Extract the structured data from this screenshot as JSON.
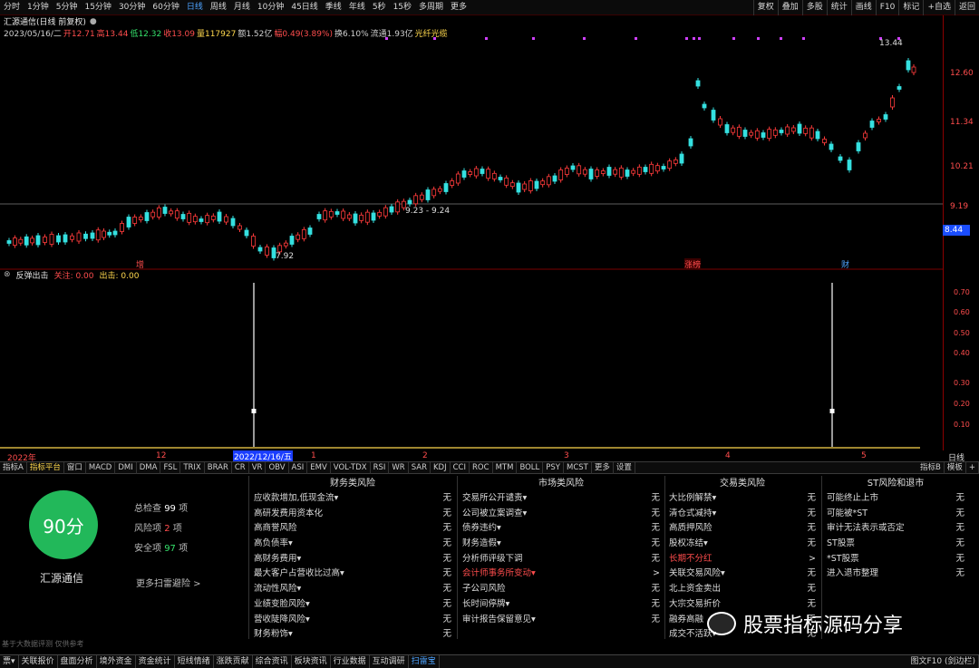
{
  "toolbar": {
    "periods": [
      "分时",
      "1分钟",
      "5分钟",
      "15分钟",
      "30分钟",
      "60分钟",
      "日线",
      "周线",
      "月线",
      "10分钟",
      "45日线",
      "季线",
      "年线",
      "5秒",
      "15秒",
      "多周期",
      "更多"
    ],
    "active_period": "日线",
    "right_buttons": [
      "复权",
      "叠加",
      "多股",
      "统计",
      "画线",
      "F10",
      "标记",
      "+自选",
      "返回"
    ]
  },
  "stock_info": {
    "title": "汇源通信(日线 前复权)",
    "date": "2023/05/16/二",
    "open": "开12.71",
    "high": "高13.44",
    "low": "低12.32",
    "close": "收13.09",
    "volume": "量117927",
    "amount": "额1.52亿",
    "change": "幅0.49(3.89%)",
    "turnover": "换6.10%",
    "float": "流通1.93亿",
    "concept": "光纤光缆"
  },
  "price_axis": [
    "12.60",
    "11.34",
    "10.21",
    "9.19"
  ],
  "current_price": "8.44",
  "annotations": {
    "high_peak": "13.44",
    "low_point": "7.92",
    "range_label": "9.23 - 9.24"
  },
  "event_markers": [
    "增",
    "涨榜",
    "财"
  ],
  "indicator": {
    "name": "反弹出击",
    "field1": "关注: 0.00",
    "field2": "出击: 0.00",
    "axis": [
      "0.70",
      "0.60",
      "0.50",
      "0.40",
      "0.30",
      "0.20",
      "0.10"
    ]
  },
  "date_axis": {
    "labels": [
      "2022年",
      "12",
      "2022/12/16/五",
      "1",
      "2",
      "3",
      "4",
      "5"
    ],
    "period": "日线"
  },
  "indicator_tabs": [
    "指标A",
    "指标平台",
    "窗口",
    "MACD",
    "DMI",
    "DMA",
    "FSL",
    "TRIX",
    "BRAR",
    "CR",
    "VR",
    "OBV",
    "ASI",
    "EMV",
    "VOL-TDX",
    "RSI",
    "WR",
    "SAR",
    "KDJ",
    "CCI",
    "ROC",
    "MTM",
    "BOLL",
    "PSY",
    "MCST",
    "更多",
    "设置"
  ],
  "indicator_tabs_right": [
    "指标B",
    "模板",
    "+"
  ],
  "score": {
    "value": "90分",
    "company": "汇源通信",
    "total_label": "总检查",
    "total": "99",
    "total_unit": "项",
    "risk_label": "风险项",
    "risk": "2",
    "risk_unit": "项",
    "safe_label": "安全项",
    "safe": "97",
    "safe_unit": "项",
    "more": "更多扫雷避险 >",
    "footer": "基于大数据评测 仅供参考"
  },
  "risk_columns": [
    {
      "title": "财务类风险",
      "items": [
        {
          "label": "应收款增加,低现金流▾",
          "status": "无"
        },
        {
          "label": "高研发费用资本化",
          "status": "无"
        },
        {
          "label": "高商誉风险",
          "status": "无"
        },
        {
          "label": "高负债率▾",
          "status": "无"
        },
        {
          "label": "高财务费用▾",
          "status": "无"
        },
        {
          "label": "最大客户占营收比过高▾",
          "status": "无"
        },
        {
          "label": "流动性风险▾",
          "status": "无"
        },
        {
          "label": "业绩变脸风险▾",
          "status": "无"
        },
        {
          "label": "营收陡降风险▾",
          "status": "无"
        },
        {
          "label": "财务粉饰▾",
          "status": "无"
        }
      ]
    },
    {
      "title": "市场类风险",
      "items": [
        {
          "label": "交易所公开谴责▾",
          "status": "无"
        },
        {
          "label": "公司被立案调查▾",
          "status": "无"
        },
        {
          "label": "债券违约▾",
          "status": "无"
        },
        {
          "label": "财务造假▾",
          "status": "无"
        },
        {
          "label": "分析师评级下调",
          "status": "无"
        },
        {
          "label": "会计师事务所变动▾",
          "status": ">",
          "red": true
        },
        {
          "label": "子公司风险",
          "status": "无"
        },
        {
          "label": "长时间停牌▾",
          "status": "无"
        },
        {
          "label": "审计报告保留意见▾",
          "status": "无"
        }
      ]
    },
    {
      "title": "交易类风险",
      "items": [
        {
          "label": "大比例解禁▾",
          "status": "无"
        },
        {
          "label": "清仓式减持▾",
          "status": "无"
        },
        {
          "label": "高质押风险",
          "status": "无"
        },
        {
          "label": "股权冻结▾",
          "status": "无"
        },
        {
          "label": "长期不分红",
          "status": ">",
          "red": true
        },
        {
          "label": "关联交易风险▾",
          "status": "无"
        },
        {
          "label": "北上资金卖出",
          "status": "无"
        },
        {
          "label": "大宗交易折价",
          "status": "无"
        },
        {
          "label": "融券高融",
          "status": "无"
        },
        {
          "label": "成交不活跃▾",
          "status": "无"
        }
      ]
    },
    {
      "title": "ST风险和退市",
      "items": [
        {
          "label": "可能终止上市",
          "status": "无"
        },
        {
          "label": "可能被*ST",
          "status": "无"
        },
        {
          "label": "审计无法表示或否定",
          "status": "无"
        },
        {
          "label": "ST股票",
          "status": "无"
        },
        {
          "label": "*ST股票",
          "status": "无"
        },
        {
          "label": "进入退市整理",
          "status": "无"
        }
      ]
    }
  ],
  "watermark": "股票指标源码分享",
  "bottom_tabs": [
    "票▾",
    "关联报价",
    "盘面分析",
    "境外资金",
    "资金统计",
    "短线情绪",
    "涨跌贡献",
    "综合资讯",
    "板块资讯",
    "行业数据",
    "互动调研",
    "扫雷宝"
  ],
  "bottom_active": "扫雷宝",
  "bottom_right": "图文F10 (剑边栏)",
  "side_label": "日线",
  "colors": {
    "up": "#ff3b3b",
    "down": "#35e0e0",
    "score_circle": "#22b85a",
    "accent": "#4da3ff"
  }
}
